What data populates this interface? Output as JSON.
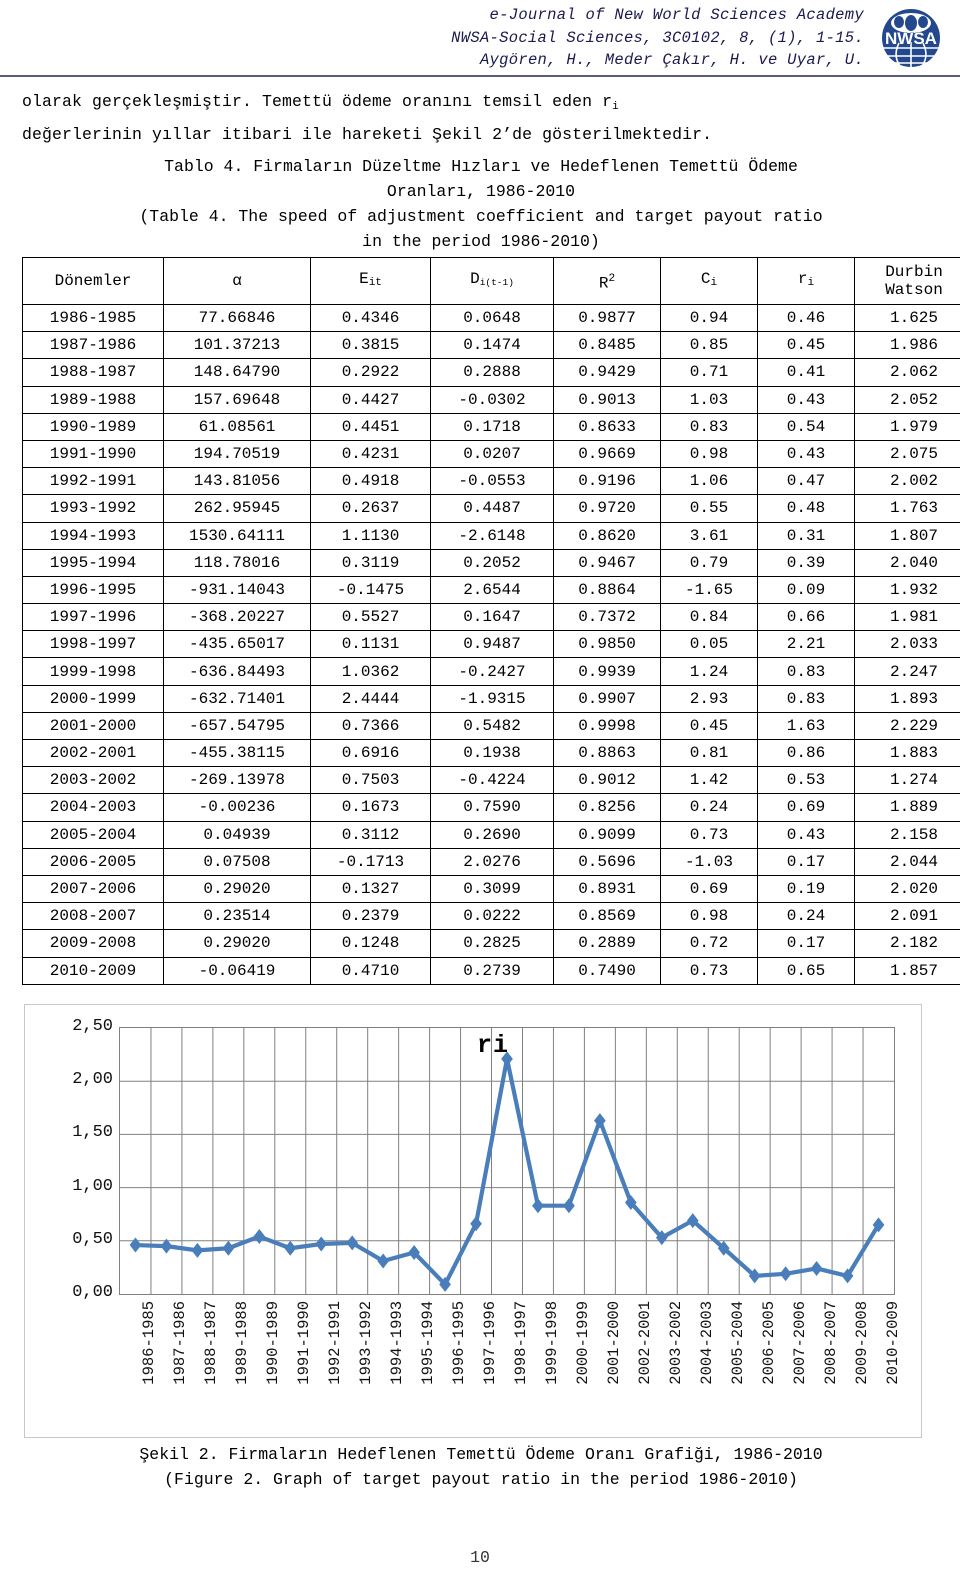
{
  "header": {
    "line1": "e-Journal of New World Sciences Academy",
    "line2": "NWSA-Social Sciences, 3C0102, 8, (1), 1-15.",
    "line3": "Aygören, H., Meder Çakır, H. ve Uyar, U.",
    "logo_text": "NWSA"
  },
  "paragraph": {
    "part1": "olarak  gerçekleşmiştir.  Temettü  ödeme  oranını  temsil  eden  r",
    "sub1": "i",
    "part2": "değerlerinin yıllar itibari ile hareketi Şekil 2’de gösterilmektedir."
  },
  "table_caption": {
    "tr_line1": "Tablo 4. Firmaların Düzeltme Hızları ve Hedeflenen Temettü Ödeme",
    "tr_line2": "Oranları, 1986-2010",
    "en_line1": "(Table 4. The speed of adjustment coefficient and target payout ratio",
    "en_line2": "in the period 1986-2010)"
  },
  "table": {
    "headers": {
      "h0": "Dönemler",
      "h1": "α",
      "h2_base": "E",
      "h2_sub": "it",
      "h3_base": "D",
      "h3_sub": "i(t-1)",
      "h4_base": "R",
      "h4_sup": "2",
      "h5_base": "C",
      "h5_sub": "i",
      "h6_base": "r",
      "h6_sub": "i",
      "h7_line1": "Durbin",
      "h7_line2": "Watson"
    },
    "rows": [
      [
        "1986-1985",
        "77.66846",
        "0.4346",
        "0.0648",
        "0.9877",
        "0.94",
        "0.46",
        "1.625"
      ],
      [
        "1987-1986",
        "101.37213",
        "0.3815",
        "0.1474",
        "0.8485",
        "0.85",
        "0.45",
        "1.986"
      ],
      [
        "1988-1987",
        "148.64790",
        "0.2922",
        "0.2888",
        "0.9429",
        "0.71",
        "0.41",
        "2.062"
      ],
      [
        "1989-1988",
        "157.69648",
        "0.4427",
        "-0.0302",
        "0.9013",
        "1.03",
        "0.43",
        "2.052"
      ],
      [
        "1990-1989",
        "61.08561",
        "0.4451",
        "0.1718",
        "0.8633",
        "0.83",
        "0.54",
        "1.979"
      ],
      [
        "1991-1990",
        "194.70519",
        "0.4231",
        "0.0207",
        "0.9669",
        "0.98",
        "0.43",
        "2.075"
      ],
      [
        "1992-1991",
        "143.81056",
        "0.4918",
        "-0.0553",
        "0.9196",
        "1.06",
        "0.47",
        "2.002"
      ],
      [
        "1993-1992",
        "262.95945",
        "0.2637",
        "0.4487",
        "0.9720",
        "0.55",
        "0.48",
        "1.763"
      ],
      [
        "1994-1993",
        "1530.64111",
        "1.1130",
        "-2.6148",
        "0.8620",
        "3.61",
        "0.31",
        "1.807"
      ],
      [
        "1995-1994",
        "118.78016",
        "0.3119",
        "0.2052",
        "0.9467",
        "0.79",
        "0.39",
        "2.040"
      ],
      [
        "1996-1995",
        "-931.14043",
        "-0.1475",
        "2.6544",
        "0.8864",
        "-1.65",
        "0.09",
        "1.932"
      ],
      [
        "1997-1996",
        "-368.20227",
        "0.5527",
        "0.1647",
        "0.7372",
        "0.84",
        "0.66",
        "1.981"
      ],
      [
        "1998-1997",
        "-435.65017",
        "0.1131",
        "0.9487",
        "0.9850",
        "0.05",
        "2.21",
        "2.033"
      ],
      [
        "1999-1998",
        "-636.84493",
        "1.0362",
        "-0.2427",
        "0.9939",
        "1.24",
        "0.83",
        "2.247"
      ],
      [
        "2000-1999",
        "-632.71401",
        "2.4444",
        "-1.9315",
        "0.9907",
        "2.93",
        "0.83",
        "1.893"
      ],
      [
        "2001-2000",
        "-657.54795",
        "0.7366",
        "0.5482",
        "0.9998",
        "0.45",
        "1.63",
        "2.229"
      ],
      [
        "2002-2001",
        "-455.38115",
        "0.6916",
        "0.1938",
        "0.8863",
        "0.81",
        "0.86",
        "1.883"
      ],
      [
        "2003-2002",
        "-269.13978",
        "0.7503",
        "-0.4224",
        "0.9012",
        "1.42",
        "0.53",
        "1.274"
      ],
      [
        "2004-2003",
        "-0.00236",
        "0.1673",
        "0.7590",
        "0.8256",
        "0.24",
        "0.69",
        "1.889"
      ],
      [
        "2005-2004",
        "0.04939",
        "0.3112",
        "0.2690",
        "0.9099",
        "0.73",
        "0.43",
        "2.158"
      ],
      [
        "2006-2005",
        "0.07508",
        "-0.1713",
        "2.0276",
        "0.5696",
        "-1.03",
        "0.17",
        "2.044"
      ],
      [
        "2007-2006",
        "0.29020",
        "0.1327",
        "0.3099",
        "0.8931",
        "0.69",
        "0.19",
        "2.020"
      ],
      [
        "2008-2007",
        "0.23514",
        "0.2379",
        "0.0222",
        "0.8569",
        "0.98",
        "0.24",
        "2.091"
      ],
      [
        "2009-2008",
        "0.29020",
        "0.1248",
        "0.2825",
        "0.2889",
        "0.72",
        "0.17",
        "2.182"
      ],
      [
        "2010-2009",
        "-0.06419",
        "0.4710",
        "0.2739",
        "0.7490",
        "0.73",
        "0.65",
        "1.857"
      ]
    ]
  },
  "chart_data": {
    "type": "line",
    "title": "",
    "series_label": "ri",
    "xlabel": "",
    "ylabel": "",
    "ylim": [
      0,
      2.5
    ],
    "ytick_labels": [
      "2,50",
      "2,00",
      "1,50",
      "1,00",
      "0,50",
      "0,00"
    ],
    "ytick_values": [
      2.5,
      2.0,
      1.5,
      1.0,
      0.5,
      0.0
    ],
    "grid": true,
    "legend_position": "inside-top-right",
    "marker": "diamond",
    "line_color": "#4a7ebb",
    "marker_color": "#4a7ebb",
    "grid_color": "#808080",
    "categories": [
      "1986-1985",
      "1987-1986",
      "1988-1987",
      "1989-1988",
      "1990-1989",
      "1991-1990",
      "1992-1991",
      "1993-1992",
      "1994-1993",
      "1995-1994",
      "1996-1995",
      "1997-1996",
      "1998-1997",
      "1999-1998",
      "2000-1999",
      "2001-2000",
      "2002-2001",
      "2003-2002",
      "2004-2003",
      "2005-2004",
      "2006-2005",
      "2007-2006",
      "2008-2007",
      "2009-2008",
      "2010-2009"
    ],
    "series": [
      {
        "name": "ri",
        "values": [
          0.46,
          0.45,
          0.41,
          0.43,
          0.54,
          0.43,
          0.47,
          0.48,
          0.31,
          0.39,
          0.09,
          0.66,
          2.21,
          0.83,
          0.83,
          1.63,
          0.86,
          0.53,
          0.69,
          0.43,
          0.17,
          0.19,
          0.24,
          0.17,
          0.65
        ]
      }
    ]
  },
  "figure_caption": {
    "tr": "Şekil 2. Firmaların Hedeflenen Temettü Ödeme Oranı Grafiği, 1986-2010",
    "en": "(Figure 2. Graph of target payout ratio in the period 1986-2010)"
  },
  "page_number": "10"
}
